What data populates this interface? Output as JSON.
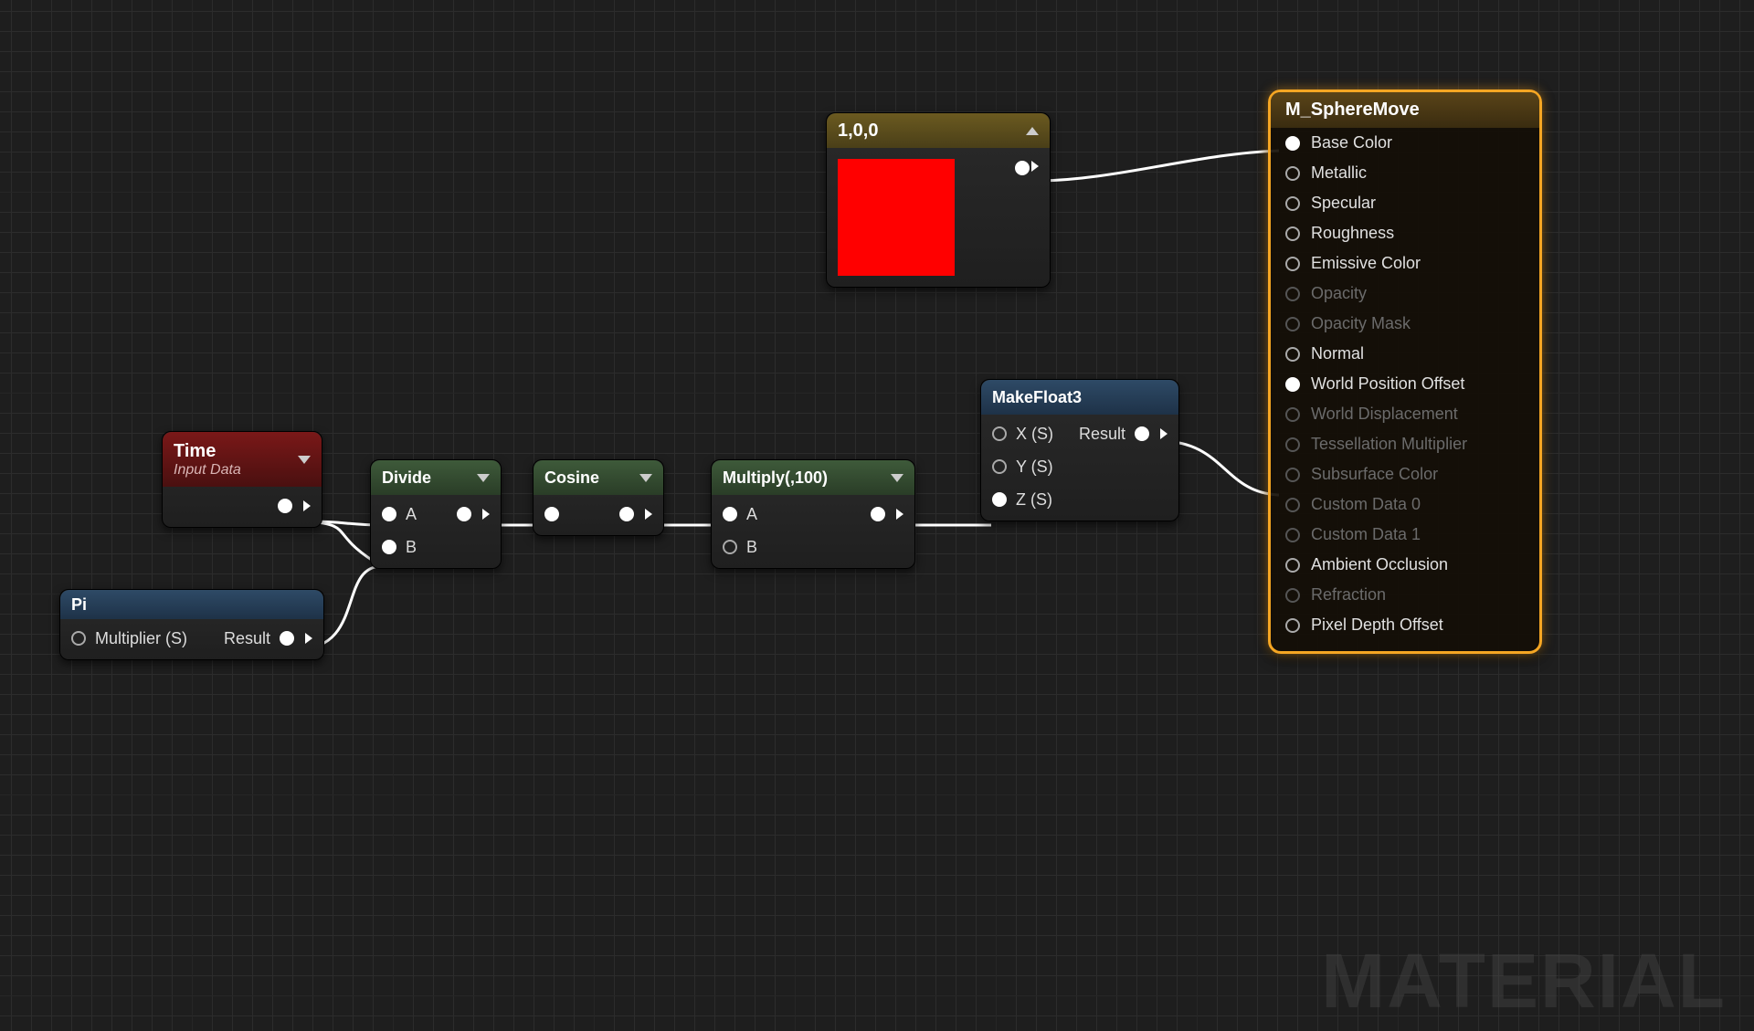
{
  "watermark": "MATERIAL",
  "nodes": {
    "time": {
      "title": "Time",
      "subtitle": "Input Data"
    },
    "pi": {
      "title": "Pi",
      "input": "Multiplier (S)",
      "output": "Result"
    },
    "divide": {
      "title": "Divide",
      "inA": "A",
      "inB": "B"
    },
    "cosine": {
      "title": "Cosine"
    },
    "multiply": {
      "title": "Multiply(,100)",
      "inA": "A",
      "inB": "B"
    },
    "makefloat3": {
      "title": "MakeFloat3",
      "inX": "X (S)",
      "inY": "Y (S)",
      "inZ": "Z (S)",
      "out": "Result"
    },
    "color": {
      "title": "1,0,0",
      "swatch": "#ff0000"
    }
  },
  "material": {
    "title": "M_SphereMove",
    "pins": [
      {
        "label": "Base Color",
        "connected": true,
        "enabled": true
      },
      {
        "label": "Metallic",
        "connected": false,
        "enabled": true
      },
      {
        "label": "Specular",
        "connected": false,
        "enabled": true
      },
      {
        "label": "Roughness",
        "connected": false,
        "enabled": true
      },
      {
        "label": "Emissive Color",
        "connected": false,
        "enabled": true
      },
      {
        "label": "Opacity",
        "connected": false,
        "enabled": false
      },
      {
        "label": "Opacity Mask",
        "connected": false,
        "enabled": false
      },
      {
        "label": "Normal",
        "connected": false,
        "enabled": true
      },
      {
        "label": "World Position Offset",
        "connected": true,
        "enabled": true
      },
      {
        "label": "World Displacement",
        "connected": false,
        "enabled": false
      },
      {
        "label": "Tessellation Multiplier",
        "connected": false,
        "enabled": false
      },
      {
        "label": "Subsurface Color",
        "connected": false,
        "enabled": false
      },
      {
        "label": "Custom Data 0",
        "connected": false,
        "enabled": false
      },
      {
        "label": "Custom Data 1",
        "connected": false,
        "enabled": false
      },
      {
        "label": "Ambient Occlusion",
        "connected": false,
        "enabled": true
      },
      {
        "label": "Refraction",
        "connected": false,
        "enabled": false
      },
      {
        "label": "Pixel Depth Offset",
        "connected": false,
        "enabled": true
      }
    ]
  }
}
